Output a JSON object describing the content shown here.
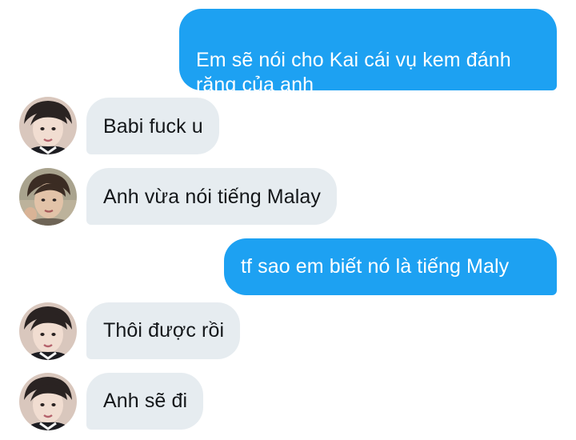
{
  "conversation": {
    "messages": [
      {
        "direction": "out",
        "avatar": "",
        "text": "Em sẽ nói cho Kai cái vụ kem đánh\nrăng của anh"
      },
      {
        "direction": "in",
        "avatar": "avatar-a",
        "text": "Babi fuck u"
      },
      {
        "direction": "in",
        "avatar": "avatar-b",
        "text": "Anh vừa nói tiếng Malay"
      },
      {
        "direction": "out",
        "avatar": "",
        "text": "tf sao em biết nó là tiếng Maly"
      },
      {
        "direction": "in",
        "avatar": "avatar-a",
        "text": "Thôi được rồi"
      },
      {
        "direction": "in",
        "avatar": "avatar-a",
        "text": "Anh sẽ đi"
      }
    ]
  },
  "colors": {
    "outgoing_bubble": "#1da1f2",
    "incoming_bubble": "#e6ecf0",
    "outgoing_text": "#ffffff",
    "incoming_text": "#14171a"
  }
}
